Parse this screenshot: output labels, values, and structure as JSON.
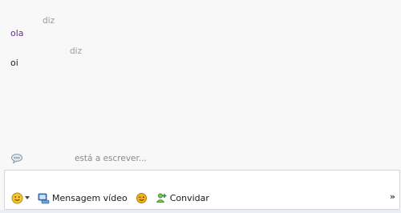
{
  "conversation": {
    "messages": [
      {
        "header": "diz",
        "text": "ola",
        "color": "#6b2d8f"
      },
      {
        "header": "diz",
        "text": "oi",
        "color": "#222222"
      }
    ],
    "typing_status": "está a escrever..."
  },
  "toolbar": {
    "emoticon_icon": "smiley-icon",
    "video_message_label": "Mensagem vídeo",
    "winks_icon": "wink-icon",
    "invite_label": "Convidar",
    "expand_label": "»"
  }
}
